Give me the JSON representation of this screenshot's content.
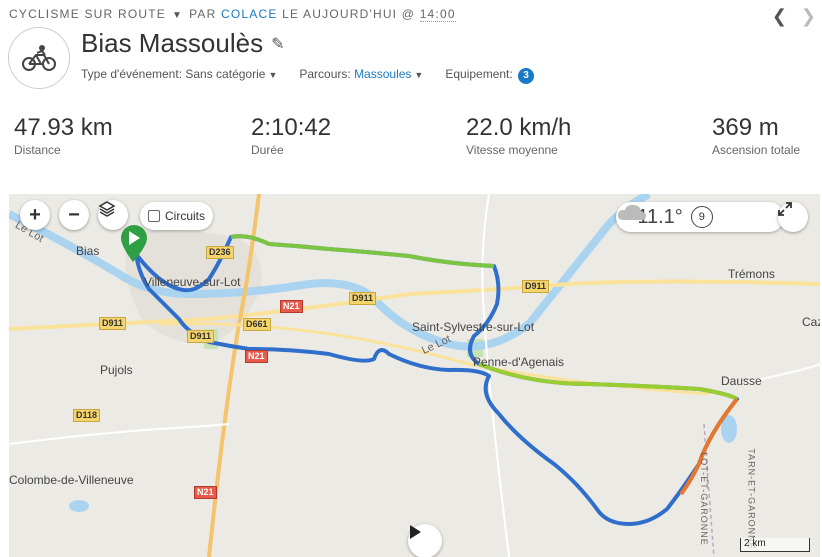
{
  "header": {
    "category": "CYCLISME SUR ROUTE",
    "by_label": "PAR",
    "author": "COLACE",
    "date_text": "LE AUJOURD'HUI @",
    "time": "14:00",
    "prev_icon": "chevron-left-icon",
    "next_icon": "chevron-right-icon"
  },
  "activity": {
    "icon": "bicycle-icon",
    "title": "Bias Massoulès",
    "event_type_label": "Type d'événement:",
    "event_type_value": "Sans catégorie",
    "route_label": "Parcours:",
    "route_value": "Massoules",
    "equipment_label": "Equipement:",
    "equipment_count": "3"
  },
  "stats": [
    {
      "value": "47.93 km",
      "label": "Distance"
    },
    {
      "value": "2:10:42",
      "label": "Durée"
    },
    {
      "value": "22.0 km/h",
      "label": "Vitesse moyenne"
    },
    {
      "value": "369 m",
      "label": "Ascension totale"
    }
  ],
  "map": {
    "circuits_label": "Circuits",
    "temperature": "11.1°",
    "wind_speed": "9",
    "scale_label": "2 km",
    "places": {
      "bias": "Bias",
      "villeneuve": "Villeneuve-sur-Lot",
      "pujols": "Pujols",
      "colombe": "Colombe-de-Villeneuve",
      "saint_sylvestre": "Saint-Sylvestre-sur-Lot",
      "penne": "Penne-d'Agenais",
      "tremons": "Trémons",
      "dausse": "Dausse",
      "caz": "Caz",
      "le_lot_1": "Le Lot",
      "le_lot_2": "Le Lot",
      "lot_et_garonne": "LOT-ET-GARONNE",
      "tarn_et_garonne": "TARN-ET-GARONNE"
    },
    "roads": {
      "d911_a": "D911",
      "d911_b": "D911",
      "d911_c": "D911",
      "d911_d": "D911",
      "d661": "D661",
      "n21_a": "N21",
      "n21_b": "N21",
      "n21_c": "N21",
      "d118": "D118",
      "d236": "D236"
    }
  }
}
